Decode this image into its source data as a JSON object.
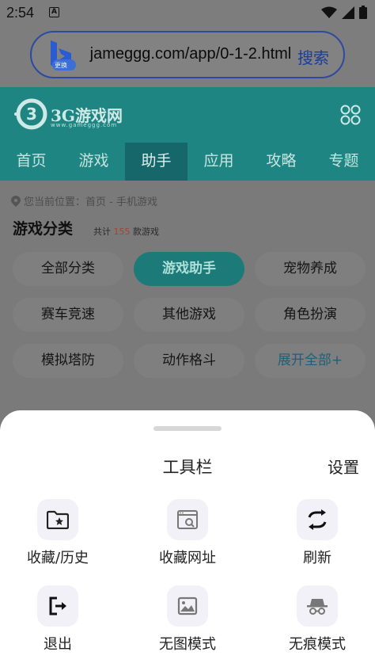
{
  "status_bar": {
    "time": "2:54",
    "notification": "A"
  },
  "address_bar": {
    "engine_badge": "更换",
    "url": " jameggg.com/app/0-1-2.html",
    "search_label": "搜索"
  },
  "site": {
    "logo_name": "3G游戏网",
    "logo_sub": "www.gameggg.com",
    "nav_tabs": [
      {
        "label": "首页"
      },
      {
        "label": "游戏"
      },
      {
        "label": "助手",
        "active": true
      },
      {
        "label": "应用"
      },
      {
        "label": "攻略"
      },
      {
        "label": "专题"
      }
    ],
    "breadcrumb": "您当前位置：首页 - 手机游戏",
    "category_title": "游戏分类",
    "count_prefix": "共计",
    "count_value": "155",
    "count_suffix": "款游戏",
    "categories": [
      {
        "label": "全部分类"
      },
      {
        "label": "游戏助手",
        "active": true
      },
      {
        "label": "宠物养成"
      },
      {
        "label": "赛车竞速"
      },
      {
        "label": "其他游戏"
      },
      {
        "label": "角色扮演"
      },
      {
        "label": "模拟塔防"
      },
      {
        "label": "动作格斗"
      },
      {
        "label": "展开全部+"
      }
    ]
  },
  "toolbar": {
    "title": "工具栏",
    "settings": "设置",
    "items": [
      {
        "label": "收藏/历史",
        "icon": "folder-star-icon"
      },
      {
        "label": "收藏网址",
        "icon": "bookmark-page-icon"
      },
      {
        "label": "刷新",
        "icon": "refresh-icon"
      },
      {
        "label": "退出",
        "icon": "exit-icon"
      },
      {
        "label": "无图模式",
        "icon": "no-image-icon"
      },
      {
        "label": "无痕模式",
        "icon": "incognito-icon"
      }
    ]
  }
}
